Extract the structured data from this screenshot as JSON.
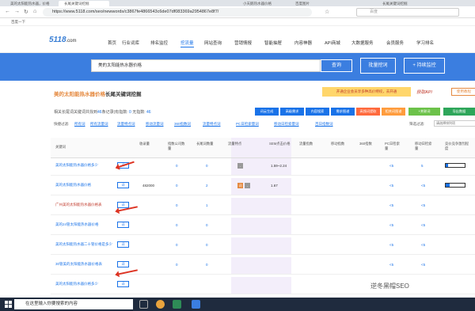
{
  "browser": {
    "tabs": [
      "美的太阳能热水器，价格",
      "长尾关键词挖掘",
      "小天鹅热水器价格",
      "百度图片",
      "长尾关键词挖掘"
    ],
    "url": "https://www.5118.com/seo/newwords/c3867fe4866543c6de07df083369a2954867e8f7/",
    "search_engine": "百度",
    "bookmark": "百度一下"
  },
  "site": {
    "logo": "5118",
    "logo_suffix": ".com",
    "nav": [
      "首页",
      "行业词库",
      "排名监控",
      "挖流量",
      "网站查询",
      "营销情报",
      "智能抽屉",
      "内容神器",
      "API商城",
      "大数据服务",
      "会员服务",
      "学习排名"
    ],
    "active_nav": "挖流量"
  },
  "search": {
    "keyword": "美的太阳能热水器价格",
    "query_btn": "查询",
    "batch_btn": "批量挖词",
    "monitor_btn": "持续监控"
  },
  "page": {
    "title_keyword": "美的太阳能热水器价格",
    "title_suffix": "长尾关键词挖掘",
    "promo": "开通企业会员享多种高价特权，去开通",
    "api_link": "获取API",
    "help": "使用教程",
    "count_text_a": "相关长尾词关键词共找到",
    "count": "46",
    "count_text_b": "条记录(有指数:",
    "index_count": "0",
    "no_index_label": "无指数:",
    "no_index_count": "46",
    "actions": [
      "词云生成",
      "高级需求",
      "内容搜索",
      "需求图谱",
      "高频词提取",
      "相关词图谱",
      "+关联词",
      "导出数据"
    ],
    "filter_label": "快捷过滤:",
    "filters": [
      "所有词",
      "所有流量词",
      "流量特点词",
      "移动流量词",
      "360指数词",
      "流量特点词",
      "PC日检索量词",
      "移动日检索量词",
      "百日指数词"
    ],
    "sort_label": "筛选过滤:",
    "sort_placeholder": "请选择排列项"
  },
  "table": {
    "columns": [
      "关键词",
      "收录量",
      "指数公司数量",
      "长尾词数量",
      "流量特点",
      "SEM点击价格",
      "流量指数",
      "移动指数",
      "360指数",
      "PC日检索量",
      "移动日检索量",
      "竞价竞争激烈程度"
    ],
    "rows": [
      {
        "keyword": "美的太阳能热水器价格多少",
        "collect": "",
        "companies": "0",
        "longtail": "0",
        "sem": "1.59~2.24",
        "pc": "<5",
        "mobile": "5",
        "comp": 0.12,
        "tags": [
          "-"
        ],
        "red": false
      },
      {
        "keyword": "美的太阳能热水器价格",
        "collect": "482000",
        "companies": "0",
        "longtail": "2",
        "sem": "1.67",
        "pc": "<5",
        "mobile": "<5",
        "comp": 0.2,
        "tags": [
          "词",
          "-"
        ],
        "red": false
      },
      {
        "keyword": "广州美的太阳能热水器价格表",
        "collect": "",
        "companies": "0",
        "longtail": "1",
        "sem": "",
        "pc": "<5",
        "mobile": "<5",
        "comp": 0,
        "tags": [],
        "red": true
      },
      {
        "keyword": "美的24管太阳能热水器价格",
        "collect": "",
        "companies": "0",
        "longtail": "0",
        "sem": "",
        "pc": "<5",
        "mobile": "<5",
        "comp": 0,
        "tags": [],
        "red": false
      },
      {
        "keyword": "美的太阳能热水器二十管价格是多少",
        "collect": "",
        "companies": "0",
        "longtail": "0",
        "sem": "",
        "pc": "<5",
        "mobile": "<5",
        "comp": 0,
        "tags": [],
        "red": false
      },
      {
        "keyword": "30管美的太阳能热水器价格表",
        "collect": "",
        "companies": "0",
        "longtail": "0",
        "sem": "",
        "pc": "<5",
        "mobile": "<5",
        "comp": 0,
        "tags": [],
        "red": false
      },
      {
        "keyword": "美的太阳能热水器价格多少",
        "collect": "",
        "companies": "",
        "longtail": "",
        "sem": "",
        "pc": "",
        "mobile": "",
        "comp": 0,
        "tags": [],
        "red": false
      }
    ],
    "select_label": "词"
  },
  "taskbar": {
    "search_placeholder": "在这里输入你要搜索的内容"
  },
  "watermark": "逆冬黑帽SEO"
}
